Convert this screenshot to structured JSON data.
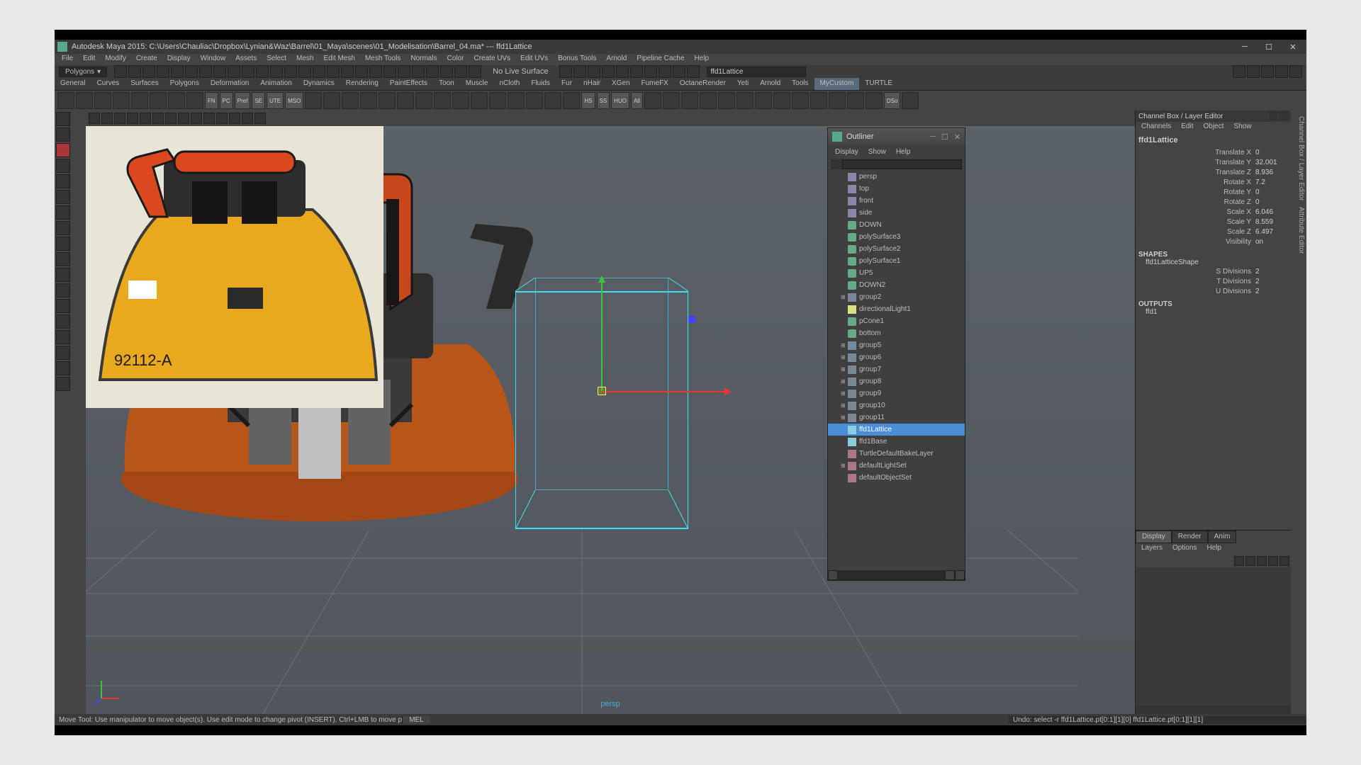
{
  "title": "Autodesk Maya 2015: C:\\Users\\Chauliac\\Dropbox\\Lynian&Waz\\Barrel\\01_Maya\\scenes\\01_Modelisation\\Barrel_04.ma*  ---  ffd1Lattice",
  "menubar": [
    "File",
    "Edit",
    "Modify",
    "Create",
    "Display",
    "Window",
    "Assets",
    "Select",
    "Mesh",
    "Edit Mesh",
    "Mesh Tools",
    "Normals",
    "Color",
    "Create UVs",
    "Edit UVs",
    "Bonus Tools",
    "Arnold",
    "Pipeline Cache",
    "Help"
  ],
  "mode_dropdown": "Polygons",
  "status_text": "No Live Surface",
  "status_search": "ffd1Lattice",
  "shelf_tabs": [
    "General",
    "Curves",
    "Surfaces",
    "Polygons",
    "Deformation",
    "Animation",
    "Dynamics",
    "Rendering",
    "PaintEffects",
    "Toon",
    "Muscle",
    "nCloth",
    "Fluids",
    "Fur",
    "nHair",
    "XGen",
    "FumeFX",
    "OctaneRender",
    "Yeti",
    "Arnold",
    "Tools",
    "MyCustom",
    "TURTLE"
  ],
  "active_shelf_tab": "MyCustom",
  "shelf_labels": [
    "FN",
    "PC",
    "Pref",
    "SE",
    "UTE",
    "MSO",
    "",
    "",
    "",
    "",
    "",
    "",
    "",
    "",
    "",
    "",
    "",
    "",
    "",
    "",
    "",
    "HS",
    "SS",
    "HUO",
    "All",
    "",
    "",
    "",
    "",
    "",
    "",
    "",
    "",
    "",
    "",
    "",
    "",
    "",
    "DSo",
    ""
  ],
  "outliner": {
    "title": "Outliner",
    "menu": [
      "Display",
      "Show",
      "Help"
    ],
    "items": [
      {
        "icon": "cam",
        "label": "persp",
        "indent": 1
      },
      {
        "icon": "cam",
        "label": "top",
        "indent": 1
      },
      {
        "icon": "cam",
        "label": "front",
        "indent": 1
      },
      {
        "icon": "cam",
        "label": "side",
        "indent": 1
      },
      {
        "icon": "mesh",
        "label": "DOWN",
        "indent": 1
      },
      {
        "icon": "mesh",
        "label": "polySurface3",
        "indent": 1
      },
      {
        "icon": "mesh",
        "label": "polySurface2",
        "indent": 1
      },
      {
        "icon": "mesh",
        "label": "polySurface1",
        "indent": 1
      },
      {
        "icon": "mesh",
        "label": "UP5",
        "indent": 1
      },
      {
        "icon": "mesh",
        "label": "DOWN2",
        "indent": 1
      },
      {
        "icon": "grp",
        "label": "group2",
        "indent": 1,
        "exp": true
      },
      {
        "icon": "light",
        "label": "directionalLight1",
        "indent": 1
      },
      {
        "icon": "mesh",
        "label": "pCone1",
        "indent": 1
      },
      {
        "icon": "mesh",
        "label": "bottom",
        "indent": 1
      },
      {
        "icon": "grp",
        "label": "group5",
        "indent": 1,
        "exp": true
      },
      {
        "icon": "grp",
        "label": "group6",
        "indent": 1,
        "exp": true
      },
      {
        "icon": "grp",
        "label": "group7",
        "indent": 1,
        "exp": true
      },
      {
        "icon": "grp",
        "label": "group8",
        "indent": 1,
        "exp": true
      },
      {
        "icon": "grp",
        "label": "group9",
        "indent": 1,
        "exp": true
      },
      {
        "icon": "grp",
        "label": "group10",
        "indent": 1,
        "exp": true
      },
      {
        "icon": "grp",
        "label": "group11",
        "indent": 1,
        "exp": true
      },
      {
        "icon": "lat",
        "label": "ffd1Lattice",
        "indent": 1,
        "sel": true
      },
      {
        "icon": "lat",
        "label": "ffd1Base",
        "indent": 1
      },
      {
        "icon": "set",
        "label": "TurtleDefaultBakeLayer",
        "indent": 1
      },
      {
        "icon": "set",
        "label": "defaultLightSet",
        "indent": 1,
        "exp": true
      },
      {
        "icon": "set",
        "label": "defaultObjectSet",
        "indent": 1
      }
    ]
  },
  "channelbox": {
    "title": "Channel Box / Layer Editor",
    "tabs": [
      "Channels",
      "Edit",
      "Object",
      "Show"
    ],
    "object": "ffd1Lattice",
    "attrs": [
      {
        "k": "Translate X",
        "v": "0"
      },
      {
        "k": "Translate Y",
        "v": "32.001"
      },
      {
        "k": "Translate Z",
        "v": "8.936"
      },
      {
        "k": "Rotate X",
        "v": "7.2"
      },
      {
        "k": "Rotate Y",
        "v": "0"
      },
      {
        "k": "Rotate Z",
        "v": "0"
      },
      {
        "k": "Scale X",
        "v": "6.046"
      },
      {
        "k": "Scale Y",
        "v": "8.559"
      },
      {
        "k": "Scale Z",
        "v": "6.497"
      },
      {
        "k": "Visibility",
        "v": "on"
      }
    ],
    "shapes_hdr": "SHAPES",
    "shape_name": "ffd1LatticeShape",
    "shape_attrs": [
      {
        "k": "S Divisions",
        "v": "2"
      },
      {
        "k": "T Divisions",
        "v": "2"
      },
      {
        "k": "U Divisions",
        "v": "2"
      }
    ],
    "outputs_hdr": "OUTPUTS",
    "output_name": "ffd1"
  },
  "layers": {
    "tabs": [
      "Display",
      "Render",
      "Anim"
    ],
    "active": "Display",
    "menu": [
      "Layers",
      "Options",
      "Help"
    ]
  },
  "right_dock": [
    "Channel Box / Layer Editor",
    "Attribute Editor"
  ],
  "help_line": "Move Tool: Use manipulator to move object(s). Use edit mode to change pivot (INSERT). Ctrl+LMB to move perp",
  "script_label": "MEL",
  "script_output": "Undo: select -r ffd1Lattice.pt[0:1][1][0] ffd1Lattice.pt[0:1][1][1]",
  "persp_label": "persp"
}
